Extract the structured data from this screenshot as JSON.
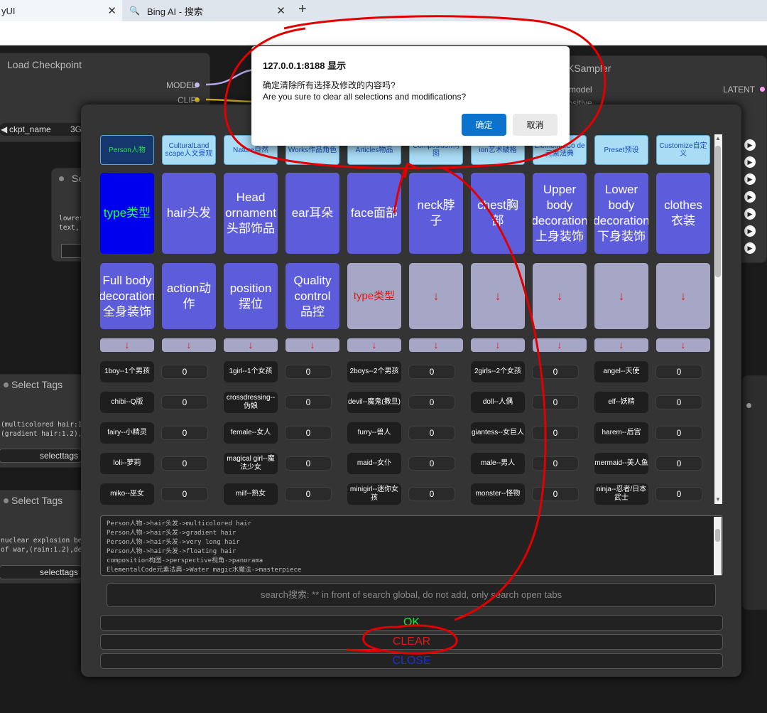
{
  "browser": {
    "tabs": [
      {
        "label": "yUI",
        "close": "✕"
      },
      {
        "label": "Bing AI - 搜索",
        "close": "✕"
      }
    ],
    "new_tab": "+"
  },
  "canvas": {
    "load_checkpoint": {
      "title": "Load Checkpoint",
      "ports": [
        "MODEL",
        "CLIP"
      ],
      "ckpt_label": "ckpt_name",
      "ckpt_value": "3Gu"
    },
    "ksampler": {
      "title": "KSampler",
      "in_model": "model",
      "in_positive": "positive",
      "out_latent": "LATENT"
    },
    "small_node": {
      "title": "Se",
      "text": "lowres\ntext,"
    },
    "select_tags_1": {
      "title": "Select Tags",
      "text": "(multicolored hair:1.2\n(gradient hair:1.2),(v",
      "button": "selecttags"
    },
    "select_tags_2": {
      "title": "Select Tags",
      "text": "nuclear explosion behi\nof war,(rain:1.2),dete",
      "button": "selecttags"
    },
    "side_arrows": [
      "▶",
      "▶",
      "▶",
      "▶",
      "▶",
      "▶",
      "▶"
    ]
  },
  "modal": {
    "categories": [
      "Person人物",
      "CulturalLandscape人文景观",
      "Nature自然",
      "WorksCharacters作品角色",
      "Articles物品",
      "Composition构图",
      "ArtisticBreaking艺术破格",
      "ElementalCode元素法典",
      "Preset预设",
      "Customize自定义"
    ],
    "categories_visible": [
      "Person人物",
      "CulturalLand scape人文景观",
      "Nature自然",
      "Works作品角色",
      "Articles物品",
      "Composition构图",
      "ion艺术破格",
      "ElementalCo de元素法典",
      "Preset预设",
      "Customize自定义"
    ],
    "subcats_row1": [
      "type类型",
      "hair头发",
      "Head ornament头部饰品",
      "ear耳朵",
      "face面部",
      "neck脖子",
      "chest胸部",
      "Upper body decoration上身装饰",
      "Lower body decoration下身装饰",
      "clothes衣装"
    ],
    "subcats_row2": [
      "Full body decoration全身装饰",
      "action动作",
      "position摆位",
      "Quality control品控",
      "type类型",
      "↓",
      "↓",
      "↓",
      "↓",
      "↓"
    ],
    "arrow_row": [
      "↓",
      "↓",
      "↓",
      "↓",
      "↓",
      "↓",
      "↓",
      "↓",
      "↓",
      "↓"
    ],
    "tags": [
      [
        {
          "tag": "1boy--1个男孩",
          "count": "0"
        },
        {
          "tag": "1girl--1个女孩",
          "count": "0"
        },
        {
          "tag": "2boys--2个男孩",
          "count": "0"
        },
        {
          "tag": "2girls--2个女孩",
          "count": "0"
        },
        {
          "tag": "angel--天使",
          "count": "0"
        }
      ],
      [
        {
          "tag": "chibi--Q版",
          "count": "0"
        },
        {
          "tag": "crossdressing--伪娘",
          "count": "0"
        },
        {
          "tag": "devil--魔鬼(撒旦)",
          "count": "0"
        },
        {
          "tag": "doll--人偶",
          "count": "0"
        },
        {
          "tag": "elf--妖精",
          "count": "0"
        }
      ],
      [
        {
          "tag": "fairy--小精灵",
          "count": "0"
        },
        {
          "tag": "female--女人",
          "count": "0"
        },
        {
          "tag": "furry--兽人",
          "count": "0"
        },
        {
          "tag": "giantess--女巨人",
          "count": "0"
        },
        {
          "tag": "harem--后宫",
          "count": "0"
        }
      ],
      [
        {
          "tag": "loli--萝莉",
          "count": "0"
        },
        {
          "tag": "magical girl--魔法少女",
          "count": "0"
        },
        {
          "tag": "maid--女仆",
          "count": "0"
        },
        {
          "tag": "male--男人",
          "count": "0"
        },
        {
          "tag": "mermaid--美人鱼",
          "count": "0"
        }
      ],
      [
        {
          "tag": "miko--巫女",
          "count": "0"
        },
        {
          "tag": "milf--熟女",
          "count": "0"
        },
        {
          "tag": "minigirl--迷你女孩",
          "count": "0"
        },
        {
          "tag": "monster--怪物",
          "count": "0"
        },
        {
          "tag": "ninja--忍者/日本武士",
          "count": "0"
        }
      ]
    ],
    "log_lines": [
      "Person人物->hair头发->multicolored hair",
      "Person人物->hair头发->gradient hair",
      "Person人物->hair头发->very long hair",
      "Person人物->hair头发->floating hair",
      "composition构图->perspective视角->panorama",
      "ElementalCode元素法典->Water magic水魔法->masterpiece"
    ],
    "search_placeholder": "search搜索:  ** in front of search global, do not add, only search open tabs",
    "ok_label": "OK",
    "clear_label": "CLEAR",
    "close_label": "CLOSE"
  },
  "dialog": {
    "title": "127.0.0.1:8188 显示",
    "message_cn": "确定清除所有选择及修改的内容吗?",
    "message_en": "Are you sure to clear all selections and modifications?",
    "ok": "确定",
    "cancel": "取消"
  },
  "colors": {
    "accent_blue": "#0b73ce",
    "annotation_red": "#e00000",
    "active_green": "#18e83a"
  }
}
